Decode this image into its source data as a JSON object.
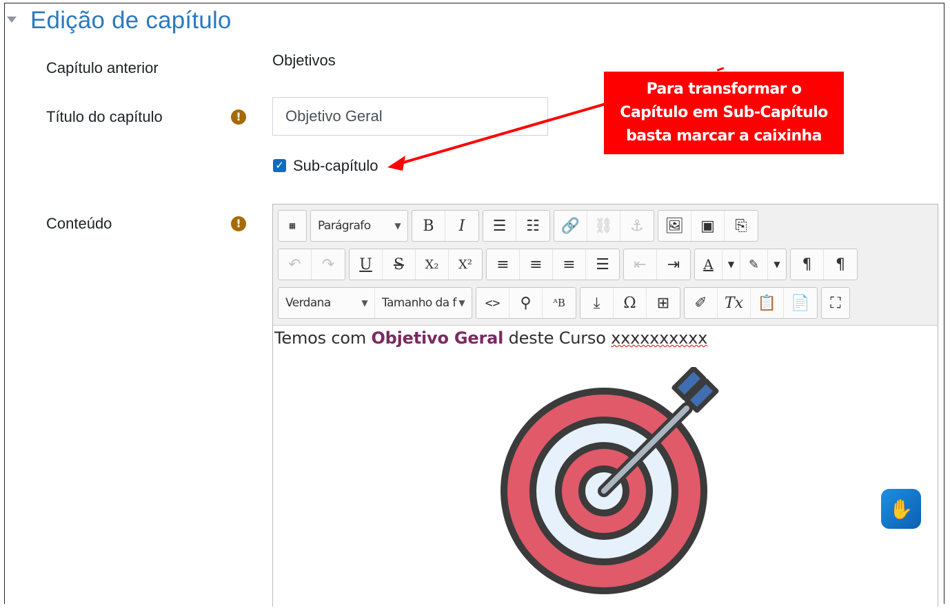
{
  "section": {
    "title": "Edição de capítulo"
  },
  "fields": {
    "previous_chapter_label": "Capítulo anterior",
    "previous_chapter_value": "Objetivos",
    "title_label": "Título do capítulo",
    "title_value": "Objetivo Geral",
    "subchapter_label": "Sub-capítulo",
    "subchapter_checked": true,
    "content_label": "Conteúdo"
  },
  "callout": {
    "line1": "Para transformar o",
    "line2": "Capítulo em Sub-Capítulo",
    "line3": "basta marcar a caixinha"
  },
  "toolbar": {
    "paragraph_select": "Parágrafo",
    "font_select": "Verdana",
    "size_select": "Tamanho da f",
    "bold": "B",
    "italic": "I",
    "underline": "U",
    "strike": "S"
  },
  "editor": {
    "text_before": "Temos com ",
    "text_bold": "Objetivo Geral",
    "text_middle": " deste Curso ",
    "text_misspelled": "xxxxxxxxxx"
  },
  "colors": {
    "accent": "#2a79c0",
    "callout": "#ff0000",
    "checkbox": "#0f6cbf",
    "required": "#a56a00",
    "bold_text": "#7a2a62"
  }
}
